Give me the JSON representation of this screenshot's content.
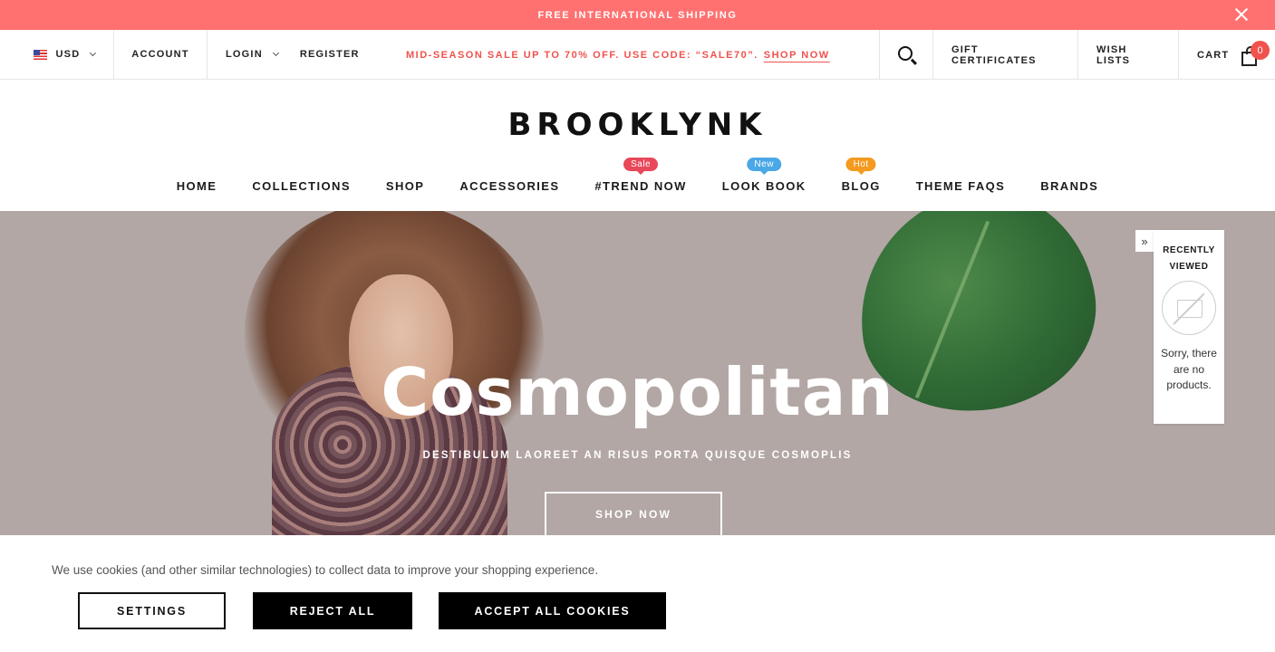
{
  "announcement": {
    "text": "FREE INTERNATIONAL SHIPPING",
    "close_icon": "close-icon"
  },
  "topbar": {
    "currency": "USD",
    "account": "ACCOUNT",
    "login": "LOGIN",
    "register": "REGISTER",
    "promo_text": "MID-SEASON SALE UP TO 70% OFF. USE CODE: “SALE70”.",
    "promo_link": "SHOP NOW",
    "gift": "GIFT CERTIFICATES",
    "wish": "WISH LISTS",
    "cart": "CART",
    "cart_count": "0"
  },
  "logo": "BROOKLYNK",
  "nav": {
    "items": [
      {
        "label": "HOME"
      },
      {
        "label": "COLLECTIONS"
      },
      {
        "label": "SHOP"
      },
      {
        "label": "ACCESSORIES"
      },
      {
        "label": "#TREND NOW",
        "badge": "Sale",
        "badge_color": "#e8485a"
      },
      {
        "label": "LOOK BOOK",
        "badge": "New",
        "badge_color": "#4aa8e6"
      },
      {
        "label": "BLOG",
        "badge": "Hot",
        "badge_color": "#f39a1f"
      },
      {
        "label": "THEME FAQS"
      },
      {
        "label": "BRANDS"
      }
    ]
  },
  "hero": {
    "title": "Cosmopolitan",
    "subtitle": "DESTIBULUM LAOREET AN RISUS PORTA QUISQUE COSMOPLIS",
    "button": "SHOP NOW"
  },
  "recently_viewed": {
    "title": "RECENTLY VIEWED",
    "empty": "Sorry, there are no products."
  },
  "cookie": {
    "text": "We use cookies (and other similar technologies) to collect data to improve your shopping experience.",
    "settings": "SETTINGS",
    "reject": "REJECT ALL",
    "accept": "ACCEPT ALL COOKIES"
  },
  "colors": {
    "accent": "#ff7170",
    "promo": "#f0524d",
    "hero_bg": "#b2a7a4"
  }
}
